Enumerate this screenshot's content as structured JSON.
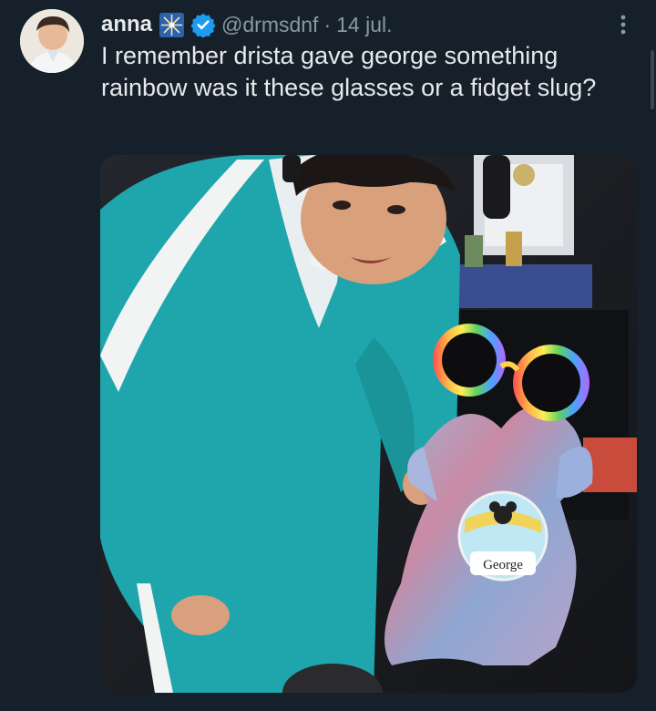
{
  "tweet": {
    "author_name": "anna",
    "handle": "@drmsdnf",
    "separator": "·",
    "date": "14 jul.",
    "text": "I remember drista gave george something rainbow was it these glasses or a fidget slug?",
    "badge_text": "George"
  },
  "icons": {
    "avatar": "avatar",
    "name_emoji": "sparkle-emoji-icon",
    "verified": "verified-badge-icon",
    "more": "more-options-icon"
  },
  "colors": {
    "background": "#15202b",
    "text": "#e7e9ea",
    "secondary": "#8b98a5",
    "verified": "#1d9bf0",
    "tracksuit": "#1fa7ad"
  }
}
